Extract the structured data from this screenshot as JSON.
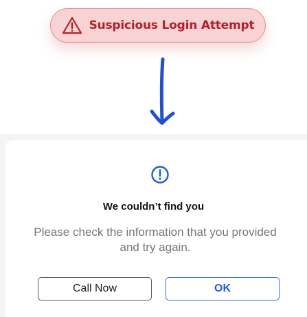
{
  "alert": {
    "icon": "warning-triangle-icon",
    "text": "Suspicious Login Attempt",
    "color": "#b3202a",
    "background": "#f8d3d3"
  },
  "arrow": {
    "icon": "down-arrow-icon",
    "color": "#1f4fd8"
  },
  "dialog": {
    "icon": "info-exclamation-icon",
    "icon_color": "#1d5fd8",
    "title": "We couldn’t find you",
    "message": "Please check the information that you provided and try again.",
    "buttons": {
      "call_label": "Call Now",
      "ok_label": "OK"
    }
  }
}
